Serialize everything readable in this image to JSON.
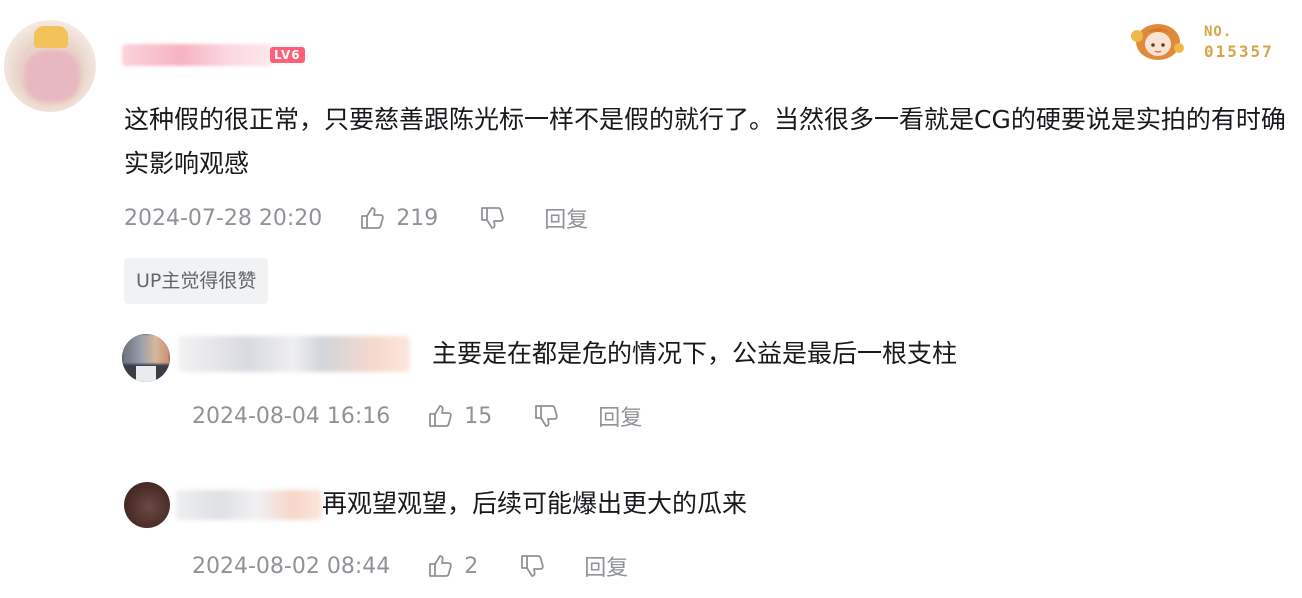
{
  "comment": {
    "level_badge": "LV6",
    "fan_badge": {
      "no_label": "NO.",
      "number": "015357"
    },
    "text": "这种假的很正常，只要慈善跟陈光标一样不是假的就行了。当然很多一看就是CG的硬要说是实拍的有时确实影响观感",
    "time": "2024-07-28 20:20",
    "likes": "219",
    "reply_label": "回复",
    "up_liked_label": "UP主觉得很赞"
  },
  "replies": [
    {
      "text": "主要是在都是危的情况下，公益是最后一根支柱",
      "time": "2024-08-04 16:16",
      "likes": "15",
      "reply_label": "回复"
    },
    {
      "text": "再观望观望，后续可能爆出更大的瓜来",
      "time": "2024-08-02 08:44",
      "likes": "2",
      "reply_label": "回复"
    }
  ],
  "icons": {
    "like": "thumbs-up-icon",
    "dislike": "thumbs-down-icon"
  }
}
